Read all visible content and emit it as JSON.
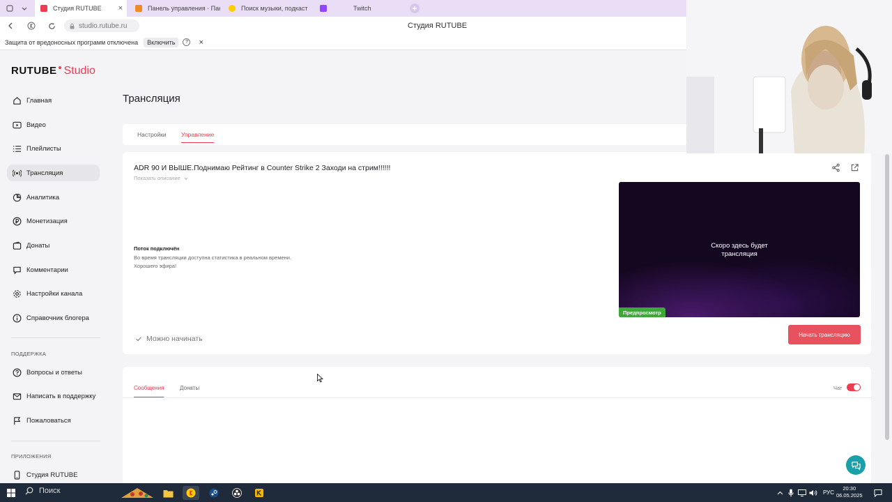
{
  "browser": {
    "tabs": [
      {
        "label": "Студия RUTUBE",
        "active": true,
        "favicon_color": "#ee3d52"
      },
      {
        "label": "Панель управления · Пан",
        "active": false,
        "favicon_color": "#f08a24"
      },
      {
        "label": "Поиск музыки, подкаст",
        "active": false,
        "favicon_color": "#ffcc00"
      },
      {
        "label": "Twitch",
        "active": false,
        "favicon_color": "#9146ff"
      }
    ],
    "url": "studio.rutube.ru",
    "page_title": "Студия RUTUBE",
    "infobar": {
      "text": "Защита от вредоносных программ отключена",
      "button": "Включить"
    }
  },
  "logo": {
    "brand": "RUTUBE",
    "product": "Studio"
  },
  "sidebar": {
    "items": [
      {
        "label": "Главная",
        "icon": "home-icon"
      },
      {
        "label": "Видео",
        "icon": "video-icon"
      },
      {
        "label": "Плейлисты",
        "icon": "playlist-icon"
      },
      {
        "label": "Трансляция",
        "icon": "broadcast-icon",
        "active": true
      },
      {
        "label": "Аналитика",
        "icon": "analytics-icon"
      },
      {
        "label": "Монетизация",
        "icon": "ruble-icon"
      },
      {
        "label": "Донаты",
        "icon": "wallet-icon"
      },
      {
        "label": "Комментарии",
        "icon": "comment-icon"
      },
      {
        "label": "Настройки канала",
        "icon": "gear-icon"
      },
      {
        "label": "Справочник блогера",
        "icon": "info-icon"
      }
    ],
    "support_title": "ПОДДЕРЖКА",
    "support_items": [
      {
        "label": "Вопросы и ответы",
        "icon": "question-icon"
      },
      {
        "label": "Написать в поддержку",
        "icon": "mail-icon"
      },
      {
        "label": "Пожаловаться",
        "icon": "flag-icon"
      }
    ],
    "apps_title": "ПРИЛОЖЕНИЯ",
    "apps_items": [
      {
        "label": "Студия RUTUBE",
        "icon": "phone-icon"
      }
    ]
  },
  "main": {
    "title": "Трансляция",
    "tabs": [
      "Настройки",
      "Управление"
    ],
    "active_tab": "Управление",
    "stream": {
      "title": "ADR 90 И ВЫШЕ.Поднимаю Рейтинг в Counter Strike 2 Заходи на стрим!!!!!!",
      "show_description": "Показать описание",
      "status_title": "Поток подключён",
      "status_line1": "Во время трансляции доступна статистика в реальном времени.",
      "status_line2": "Хорошего эфира!",
      "ready": "Можно начинать",
      "preview_text1": "Скоро здесь будет",
      "preview_text2": "трансляция",
      "preview_badge": "Предпросмотр",
      "start_button": "Начать трансляцию"
    },
    "chat": {
      "tabs": [
        "Сообщения",
        "Донаты"
      ],
      "active_tab": "Сообщения",
      "chat_label": "Чат",
      "chat_enabled": true
    }
  },
  "taskbar": {
    "search": "Поиск",
    "lang": "РУС",
    "time": "20:30",
    "date": "06.05.2025"
  },
  "colors": {
    "accent": "#ee3d52",
    "preview_badge": "#3fa63a",
    "help_fab": "#1aa0a8"
  }
}
